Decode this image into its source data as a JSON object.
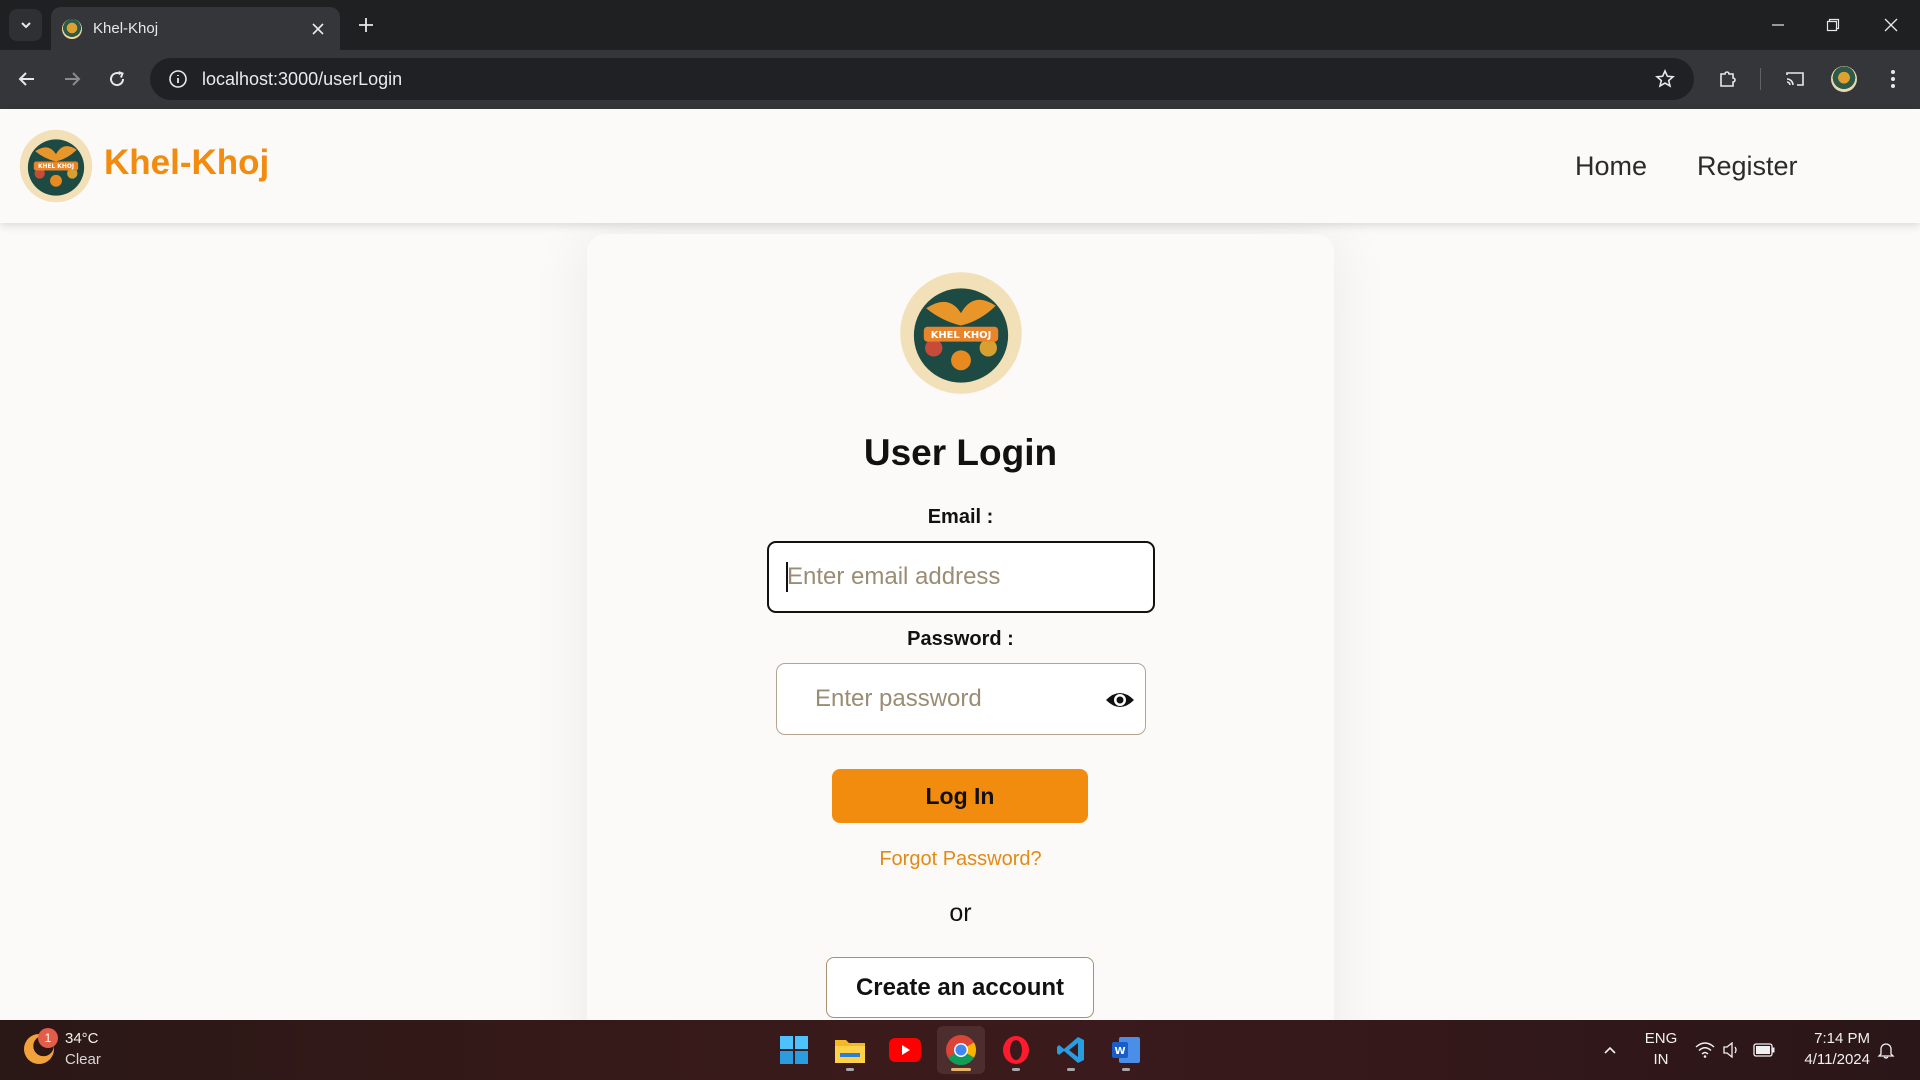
{
  "browser": {
    "tab_title": "Khel-Khoj",
    "url": "localhost:3000/userLogin"
  },
  "site": {
    "brand": "Khel-Khoj",
    "logo_text": "KHEL KHOJ",
    "nav": [
      {
        "label": "Home"
      },
      {
        "label": "Register"
      }
    ]
  },
  "login": {
    "title": "User Login",
    "email_label": "Email :",
    "email_placeholder": "Enter email address",
    "password_label": "Password :",
    "password_placeholder": "Enter password",
    "login_button": "Log In",
    "forgot_link": "Forgot Password?",
    "or_text": "or",
    "create_button": "Create an account"
  },
  "taskbar": {
    "weather_badge": "1",
    "weather_temp": "34°C",
    "weather_desc": "Clear",
    "lang_top": "ENG",
    "lang_bottom": "IN",
    "time": "7:14 PM",
    "date": "4/11/2024",
    "apps": [
      "start-icon",
      "file-explorer-icon",
      "youtube-icon",
      "chrome-icon",
      "opera-icon",
      "vscode-icon",
      "word-icon"
    ]
  },
  "colors": {
    "accent": "#f28c0f",
    "brand_text": "#f28c11",
    "link": "#e28a14",
    "chrome_dark": "#1f2022",
    "chrome_toolbar": "#35363a"
  }
}
